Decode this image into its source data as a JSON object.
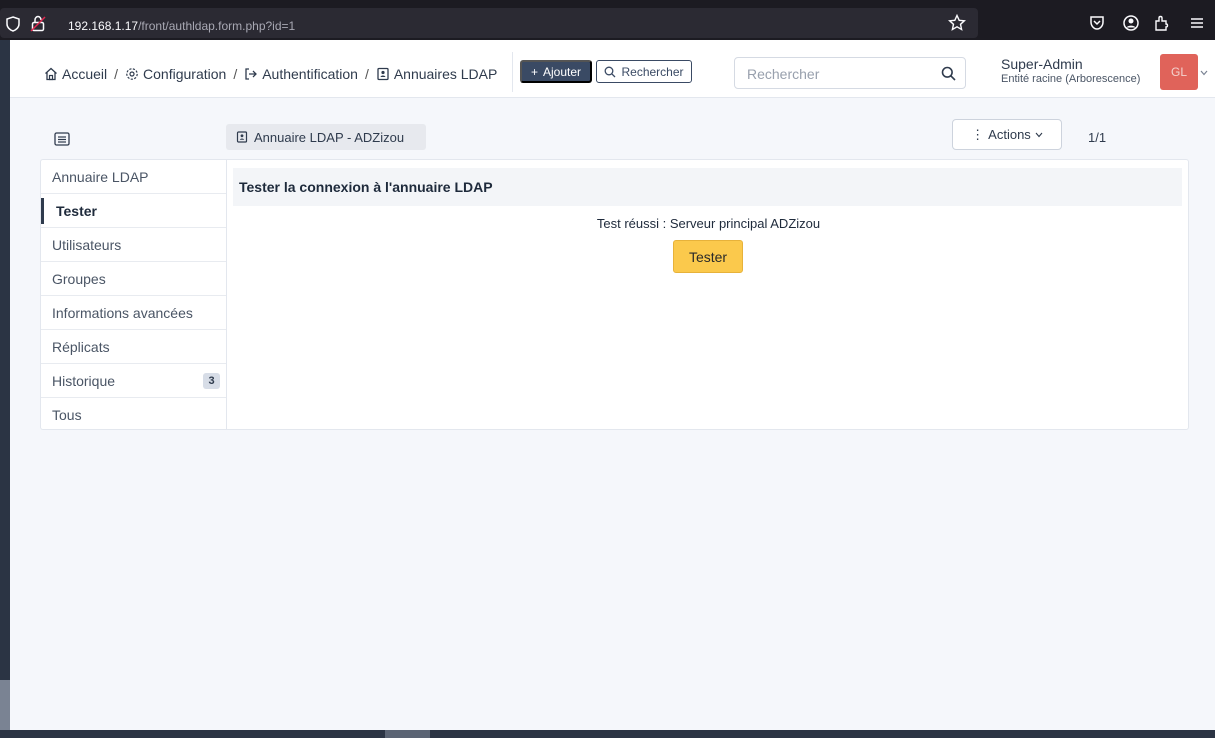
{
  "browser": {
    "url_host": "192.168.1.17",
    "url_path": "/front/authldap.form.php?id=1",
    "icons": [
      "shield-icon",
      "insecure-lock-icon",
      "bookmark-star-icon",
      "pocket-icon",
      "account-icon",
      "extensions-icon",
      "menu-icon"
    ]
  },
  "breadcrumb": [
    {
      "label": "Accueil",
      "icon": "home-icon"
    },
    {
      "label": "Configuration",
      "icon": "gear-icon"
    },
    {
      "label": "Authentification",
      "icon": "sign-in-icon"
    },
    {
      "label": "Annuaires LDAP",
      "icon": "address-book-icon"
    }
  ],
  "toolbar": {
    "add_label": "Ajouter",
    "search_label": "Rechercher"
  },
  "search": {
    "placeholder": "Rechercher"
  },
  "user": {
    "name": "Super-Admin",
    "entity": "Entité racine (Arborescence)",
    "initials": "GL",
    "avatar_color": "#e0635a"
  },
  "item": {
    "title": "Annuaire LDAP - ADZizou",
    "actions_label": "Actions",
    "pager": "1/1"
  },
  "tabs": [
    {
      "label": "Annuaire LDAP",
      "active": false,
      "badge": ""
    },
    {
      "label": "Tester",
      "active": true,
      "badge": ""
    },
    {
      "label": "Utilisateurs",
      "active": false,
      "badge": ""
    },
    {
      "label": "Groupes",
      "active": false,
      "badge": ""
    },
    {
      "label": "Informations avancées",
      "active": false,
      "badge": ""
    },
    {
      "label": "Réplicats",
      "active": false,
      "badge": ""
    },
    {
      "label": "Historique",
      "active": false,
      "badge": "3"
    },
    {
      "label": "Tous",
      "active": false,
      "badge": ""
    }
  ],
  "test_panel": {
    "heading": "Tester la connexion à l'annuaire LDAP",
    "result": "Test réussi : Serveur principal ADZizou",
    "button_label": "Tester",
    "button_color": "#fbc94c"
  }
}
